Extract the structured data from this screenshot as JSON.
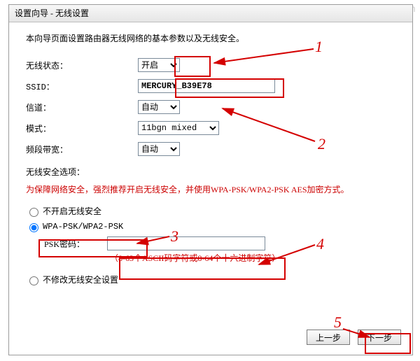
{
  "watermark": "www.it528.com",
  "title": "设置向导 - 无线设置",
  "intro": "本向导页面设置路由器无线网络的基本参数以及无线安全。",
  "form": {
    "wireless_state": {
      "label": "无线状态：",
      "value": "开启"
    },
    "ssid": {
      "label": "SSID：",
      "value": "MERCURY_B39E78"
    },
    "channel": {
      "label": "信道：",
      "value": "自动"
    },
    "mode": {
      "label": "模式：",
      "value": "11bgn mixed"
    },
    "bandwidth": {
      "label": "频段带宽：",
      "value": "自动"
    }
  },
  "security": {
    "title": "无线安全选项：",
    "recommend": "为保障网络安全，强烈推荐开启无线安全，并使用WPA-PSK/WPA2-PSK AES加密方式。",
    "options": [
      "不开启无线安全",
      "WPA-PSK/WPA2-PSK",
      "不修改无线安全设置"
    ],
    "psk_label": "PSK密码：",
    "psk_value": "",
    "psk_hint": "（8-63个ASCII码字符或8-64个十六进制字符）"
  },
  "buttons": {
    "prev": "上一步",
    "next": "下一步"
  },
  "annotations": [
    "1",
    "2",
    "3",
    "4",
    "5"
  ]
}
